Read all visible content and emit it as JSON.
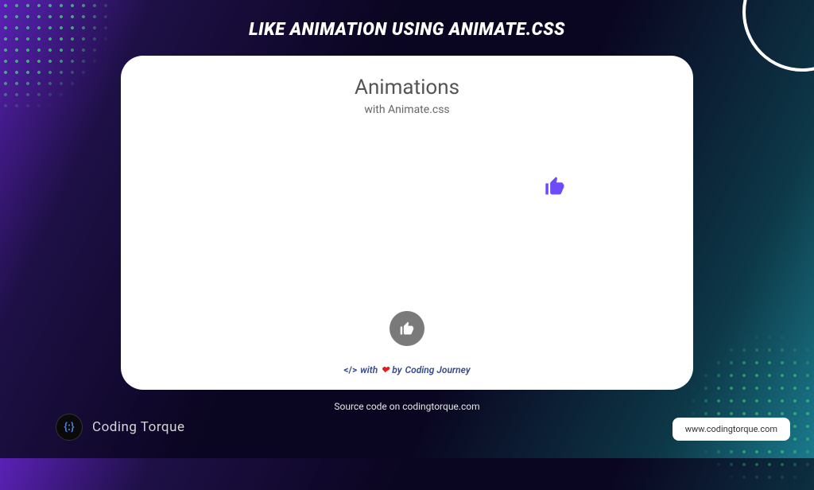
{
  "page_title": "LIKE ANIMATION USING ANIMATE.CSS",
  "card": {
    "heading": "Animations",
    "subheading": "with Animate.css"
  },
  "credit": {
    "with": "with",
    "by": "by",
    "author": "Coding Journey"
  },
  "source_text": "Source code on codingtorque.com",
  "brand": {
    "name": "Coding Torque",
    "logo_symbol": "{:}"
  },
  "url_pill": "www.codingtorque.com"
}
